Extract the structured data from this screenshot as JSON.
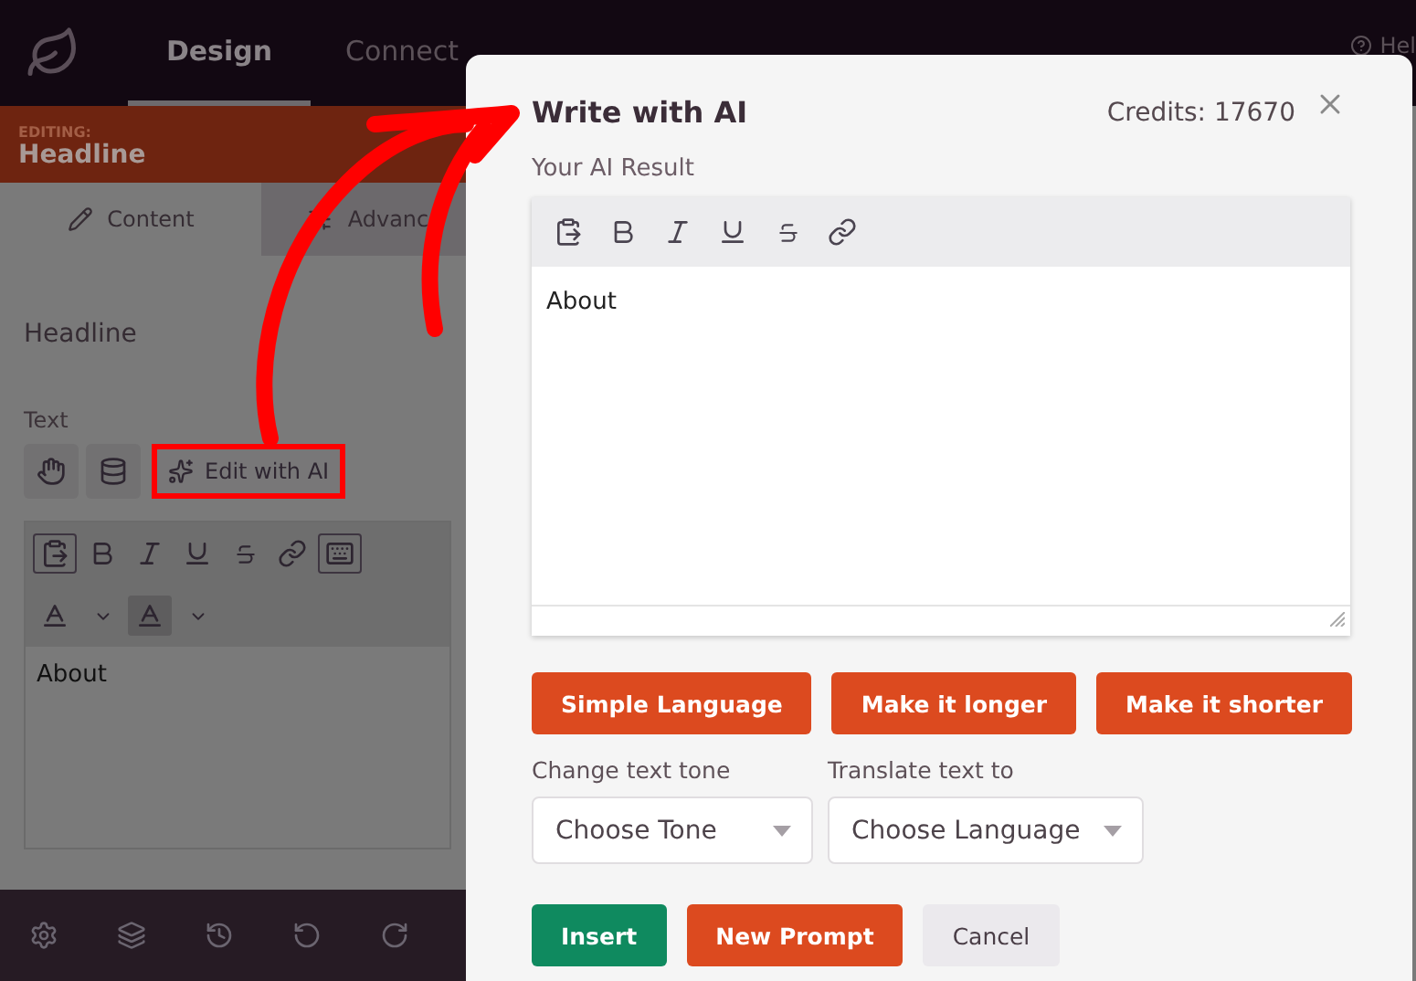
{
  "header": {
    "tabs": [
      {
        "label": "Design",
        "selected": true
      },
      {
        "label": "Connect",
        "selected": false
      }
    ],
    "help_label": "Hel"
  },
  "editing_bar": {
    "caption": "EDITING:",
    "title": "Headline"
  },
  "panel_tabs": [
    {
      "label": "Content",
      "selected": true
    },
    {
      "label": "Advanc",
      "selected": false
    }
  ],
  "section_title": "Headline",
  "text_label": "Text",
  "ai_button": {
    "label": "Edit with AI",
    "highlighted": true
  },
  "editor": {
    "content": "About"
  },
  "modal": {
    "title": "Write with AI",
    "credits": "Credits: 17670",
    "result_label": "Your AI Result",
    "result_text": "About",
    "actions": [
      "Simple Language",
      "Make it longer",
      "Make it shorter"
    ],
    "selects": [
      {
        "label": "Change text tone",
        "placeholder": "Choose Tone"
      },
      {
        "label": "Translate text to",
        "placeholder": "Choose Language"
      }
    ],
    "buttons": [
      {
        "label": "Insert",
        "kind": "primary"
      },
      {
        "label": "New Prompt",
        "kind": "accent"
      },
      {
        "label": "Cancel",
        "kind": "secondary"
      }
    ]
  }
}
